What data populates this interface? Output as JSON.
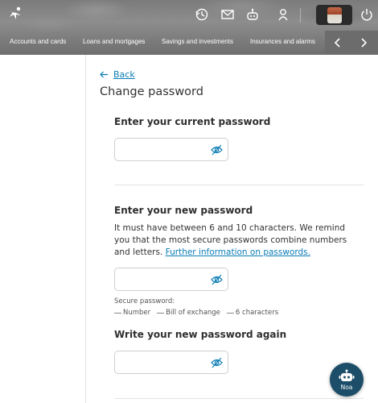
{
  "header": {
    "nav_items": [
      "Accounts and cards",
      "Loans and mortgages",
      "Savings and investments",
      "Insurances and alarms"
    ],
    "icons": [
      "logo-star-icon",
      "history-icon",
      "mail-icon",
      "robot-icon",
      "profile-icon",
      "power-icon"
    ]
  },
  "page": {
    "back_label": "Back",
    "title": "Change password"
  },
  "current": {
    "title": "Enter your current password",
    "value": ""
  },
  "new": {
    "title": "Enter your new password",
    "help_text": "It must have between 6 and 10 characters. We remind you that the most secure passwords combine numbers and letters. ",
    "help_link": "Further information on passwords.",
    "value": ""
  },
  "secure": {
    "label": "Secure password:",
    "rules": [
      "Number",
      "Bill of exchange",
      "6 characters"
    ]
  },
  "repeat": {
    "title": "Write your new password again",
    "value": ""
  },
  "assistant": {
    "label": "Noa"
  },
  "colors": {
    "link": "#0a7cb5",
    "assistant_bg": "#1c4d69",
    "header_gray": "#7d7d7d"
  }
}
